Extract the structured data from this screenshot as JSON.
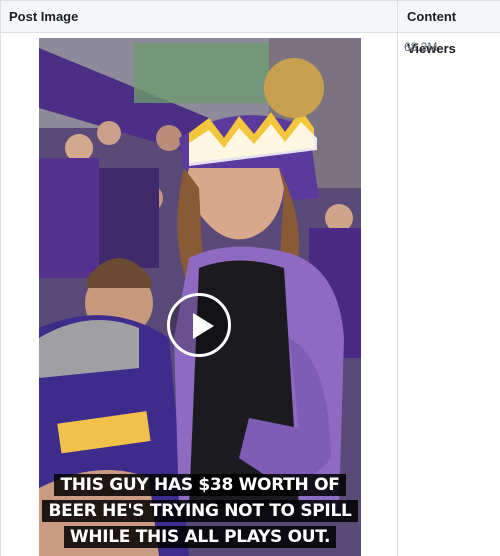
{
  "table": {
    "headers": {
      "post_image": "Post Image",
      "content_viewers": "Content Viewers"
    },
    "rows": [
      {
        "content_viewers": "68.2M",
        "video_caption": "THIS GUY HAS $38 WORTH OF BEER HE'S TRYING NOT TO SPILL WHILE THIS ALL PLAYS OUT.",
        "media_type": "video"
      }
    ]
  },
  "icons": {
    "play": "play-icon"
  },
  "colors": {
    "header_bg": "#f5f6f7",
    "border": "#dcdfe4",
    "vikings_purple": "#4f2683",
    "vikings_gold": "#ffc62f"
  }
}
